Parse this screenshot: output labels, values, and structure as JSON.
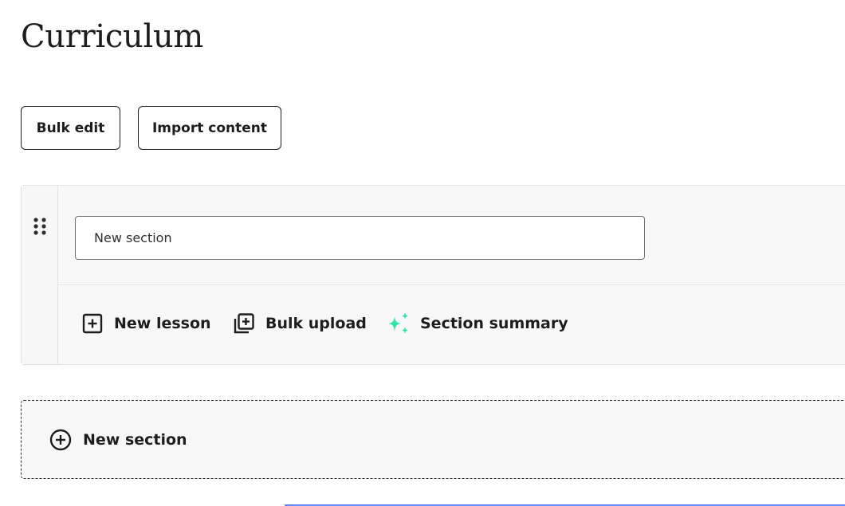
{
  "page": {
    "title": "Curriculum"
  },
  "toolbar": {
    "bulk_edit_label": "Bulk edit",
    "import_label": "Import content"
  },
  "section": {
    "title_value": "New section",
    "actions": {
      "new_lesson_label": "New lesson",
      "bulk_upload_label": "Bulk upload",
      "section_summary_label": "Section summary"
    }
  },
  "add_section": {
    "label": "New section"
  },
  "icons": {
    "drag": "drag-handle-icon",
    "new_lesson": "plus-square-icon",
    "bulk_upload": "stacked-plus-square-icon",
    "section_summary": "sparkles-icon",
    "add_section": "plus-circle-icon"
  },
  "colors": {
    "text": "#1c1d1f",
    "sparkle": "#2ee6a6",
    "border": "#e1e2e3",
    "focus_line": "#5b8def"
  }
}
